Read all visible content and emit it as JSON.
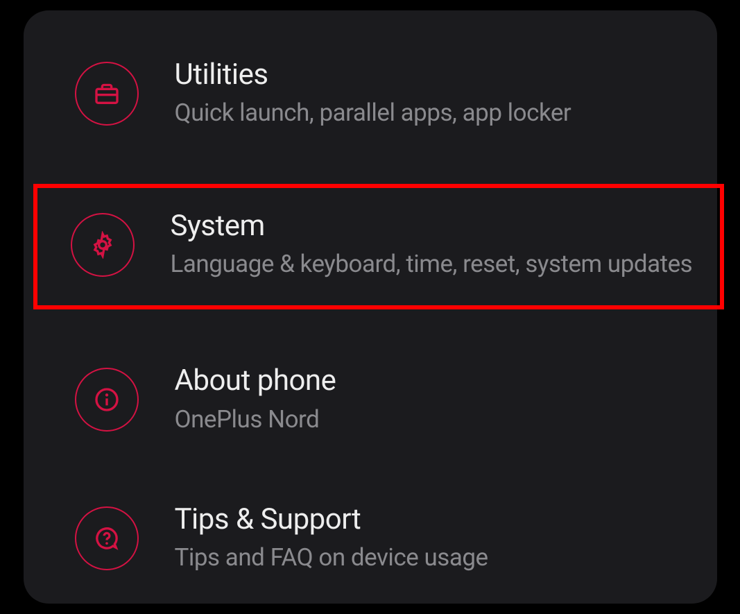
{
  "settings": {
    "items": [
      {
        "icon": "briefcase-icon",
        "title": "Utilities",
        "subtitle": "Quick launch, parallel apps, app locker",
        "highlighted": false
      },
      {
        "icon": "gear-icon",
        "title": "System",
        "subtitle": "Language & keyboard, time, reset, system updates",
        "highlighted": true
      },
      {
        "icon": "info-icon",
        "title": "About phone",
        "subtitle": "OnePlus Nord",
        "highlighted": false
      },
      {
        "icon": "question-icon",
        "title": "Tips & Support",
        "subtitle": "Tips and FAQ on device usage",
        "highlighted": false
      }
    ]
  },
  "colors": {
    "accent": "#d41243",
    "highlight_border": "#ff0000",
    "panel_bg": "#1b1b1e"
  }
}
